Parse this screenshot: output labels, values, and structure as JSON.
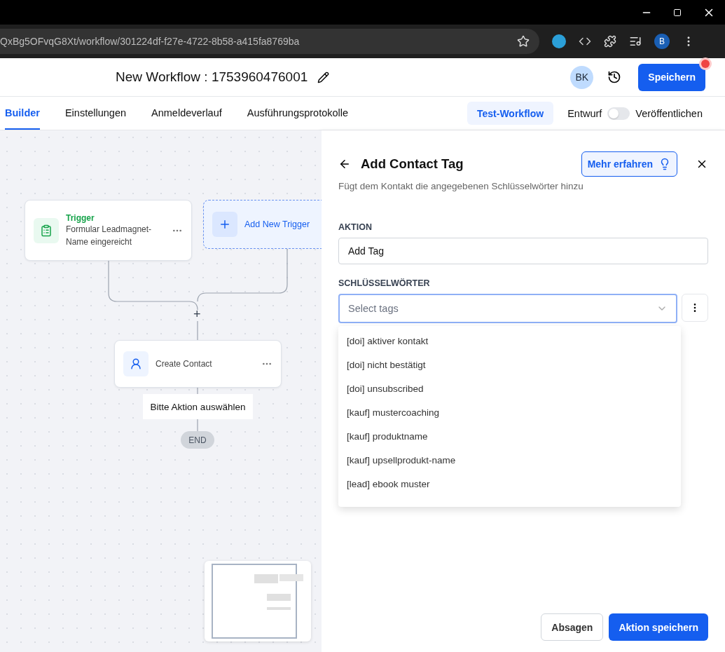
{
  "browser": {
    "url": "QxBg5OFvqG8Xt/workflow/301224df-f27e-4722-8b58-a415fa8769ba",
    "profile_initial": "B"
  },
  "header": {
    "title": "New Workflow : 1753960476001",
    "avatar": "BK",
    "save_button": "Speichern",
    "has_notification": true
  },
  "tabs": [
    {
      "label": "Builder",
      "selected": true
    },
    {
      "label": "Einstellungen",
      "selected": false
    },
    {
      "label": "Anmeldeverlauf",
      "selected": false
    },
    {
      "label": "Ausführungsprotokolle",
      "selected": false
    }
  ],
  "test_button": "Test-Workflow",
  "status_label": "Entwurf",
  "publish": {
    "on": false,
    "label": "Veröffentlichen"
  },
  "canvas": {
    "trigger": {
      "title": "Trigger",
      "description": "Formular Leadmagnet-Name eingereicht"
    },
    "add_trigger": "Add New Trigger",
    "junction": "+",
    "action": "Create Contact",
    "hint": "Bitte Aktion auswählen",
    "end": "END"
  },
  "panel": {
    "title": "Add Contact Tag",
    "subtitle": "Fügt dem Kontakt die angegebenen Schlüsselwörter hinzu",
    "learn_more": "Mehr erfahren",
    "action_label": "AKTION",
    "action_value": "Add Tag",
    "keywords_label": "SCHLÜSSELWÖRTER",
    "keywords_placeholder": "Select tags",
    "options": [
      "[doi] aktiver kontakt",
      "[doi] nicht bestätigt",
      "[doi] unsubscribed",
      "[kauf] mustercoaching",
      "[kauf] produktname",
      "[kauf] upsellprodukt-name",
      "[lead] ebook muster"
    ],
    "cancel": "Absagen",
    "save": "Aktion speichern"
  }
}
